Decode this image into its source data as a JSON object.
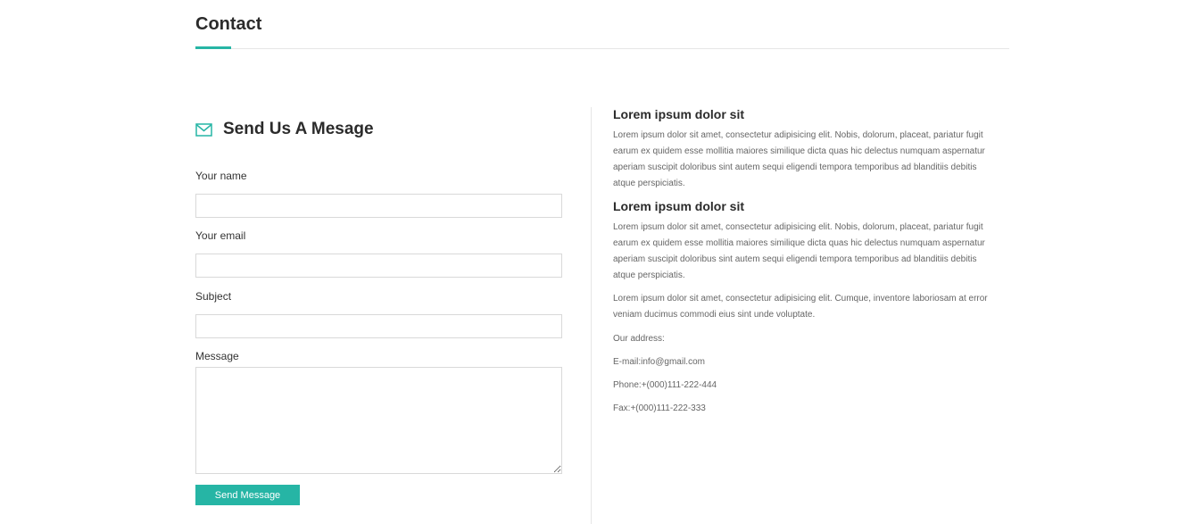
{
  "section": {
    "title": "Contact",
    "accent_color": "#26b5a5"
  },
  "form": {
    "heading": "Send Us A Mesage",
    "heading_icon": "envelope-icon",
    "name_label": "Your name",
    "name_value": "",
    "email_label": "Your email",
    "email_value": "",
    "subject_label": "Subject",
    "subject_value": "",
    "message_label": "Message",
    "message_value": "",
    "submit_label": "Send Message"
  },
  "info": {
    "blocks": [
      {
        "heading": "Lorem ipsum dolor sit",
        "text": "Lorem ipsum dolor sit amet, consectetur adipisicing elit. Nobis, dolorum, placeat, pariatur fugit earum ex quidem esse mollitia maiores similique dicta quas hic delectus numquam aspernatur aperiam suscipit doloribus sint autem sequi eligendi tempora temporibus ad blanditiis debitis atque perspiciatis."
      },
      {
        "heading": "Lorem ipsum dolor sit",
        "text": "Lorem ipsum dolor sit amet, consectetur adipisicing elit. Nobis, dolorum, placeat, pariatur fugit earum ex quidem esse mollitia maiores similique dicta quas hic delectus numquam aspernatur aperiam suscipit doloribus sint autem sequi eligendi tempora temporibus ad blanditiis debitis atque perspiciatis."
      }
    ],
    "extra_text": "Lorem ipsum dolor sit amet, consectetur adipisicing elit. Cumque, inventore laboriosam at error veniam ducimus commodi eius sint unde voluptate.",
    "address_label": "Our address:",
    "email_line": "E-mail:info@gmail.com",
    "phone_line": "Phone:+(000)111-222-444",
    "fax_line": "Fax:+(000)111-222-333"
  }
}
